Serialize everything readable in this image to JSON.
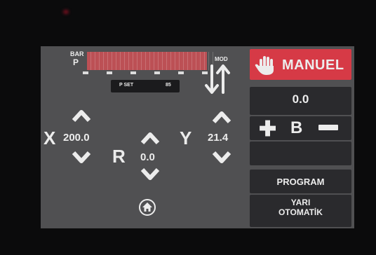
{
  "colors": {
    "accent": "#d63a46",
    "screen_bg": "#505052",
    "panel": "#2a2a2d",
    "text": "#ececec"
  },
  "pressure": {
    "unit_label": "BAR",
    "axis_label": "P",
    "fill_fraction": 0.95
  },
  "pset": {
    "label": "P SET",
    "value": "85"
  },
  "mod": {
    "label": "MOD",
    "icon": "up-down-arrows-icon"
  },
  "mode_button": {
    "icon": "hand-icon",
    "label": "MANUEL"
  },
  "value_display": "0.0",
  "b_control": {
    "plus_icon": "plus-icon",
    "label": "B",
    "minus_icon": "minus-icon"
  },
  "axes": {
    "x": {
      "label": "X",
      "value": "200.0"
    },
    "r": {
      "label": "R",
      "value": "0.0"
    },
    "y": {
      "label": "Y",
      "value": "21.4"
    }
  },
  "buttons": {
    "program": "PROGRAM",
    "yari_line1": "YARI",
    "yari_line2": "OTOMATİK"
  },
  "home": {
    "icon": "home-icon"
  }
}
